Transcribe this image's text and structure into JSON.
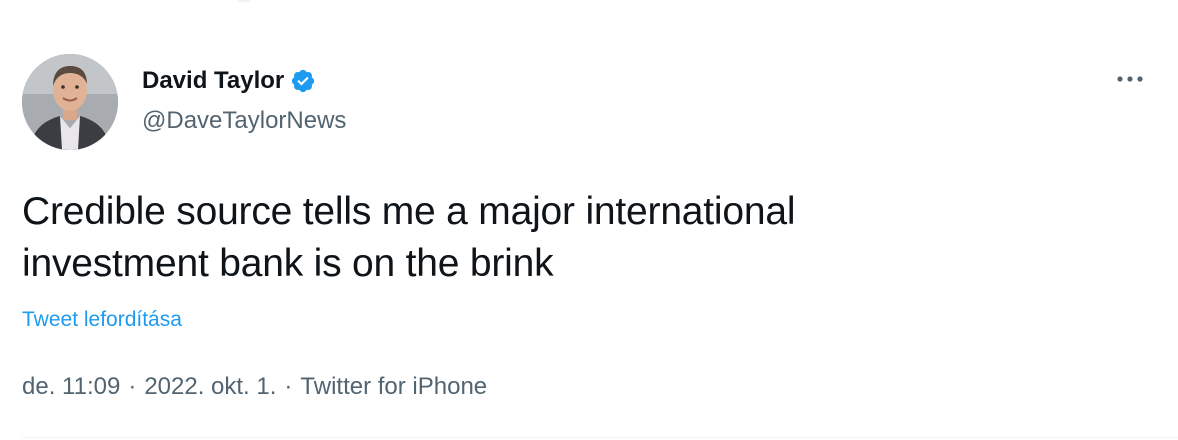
{
  "author": {
    "display_name": "David Taylor",
    "handle": "@DaveTaylorNews",
    "verified": true
  },
  "tweet": {
    "text_line1": "Credible source tells me a major international",
    "text_line2": "investment bank is on the brink",
    "translate_label": "Tweet lefordítása"
  },
  "meta": {
    "time": "de. 11:09",
    "separator": "·",
    "date": "2022. okt. 1.",
    "source": "Twitter for iPhone"
  },
  "icons": {
    "avatar": "avatar-photo",
    "verified": "verified-badge-icon",
    "more": "more-options-icon"
  },
  "colors": {
    "text": "#0f1419",
    "secondary": "#536471",
    "link": "#1d9bf0",
    "verified": "#1d9bf0",
    "divider": "#eff3f4"
  }
}
